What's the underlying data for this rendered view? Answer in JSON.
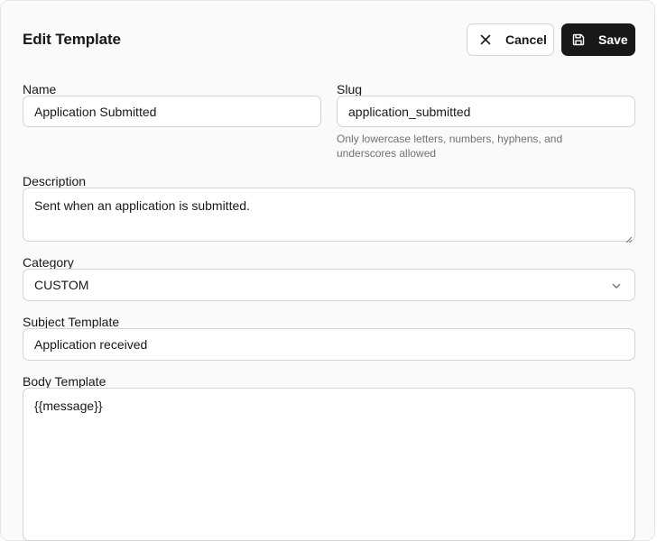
{
  "header": {
    "title": "Edit Template",
    "cancel_label": "Cancel",
    "save_label": "Save",
    "cancel_icon": "close-icon",
    "save_icon": "floppy-disk-icon"
  },
  "form": {
    "name": {
      "label": "Name",
      "value": "Application Submitted"
    },
    "slug": {
      "label": "Slug",
      "value": "application_submitted",
      "hint": "Only lowercase letters, numbers, hyphens, and underscores allowed"
    },
    "description": {
      "label": "Description",
      "value": "Sent when an application is submitted."
    },
    "category": {
      "label": "Category",
      "value": "CUSTOM",
      "icon": "chevron-down-icon"
    },
    "subject": {
      "label": "Subject Template",
      "value": "Application received"
    },
    "body": {
      "label": "Body Template",
      "value": "{{message}}"
    }
  },
  "colors": {
    "primary": "#18181b",
    "border": "#d4d4d8",
    "muted_text": "#71717a",
    "panel_bg": "#fafafa"
  }
}
